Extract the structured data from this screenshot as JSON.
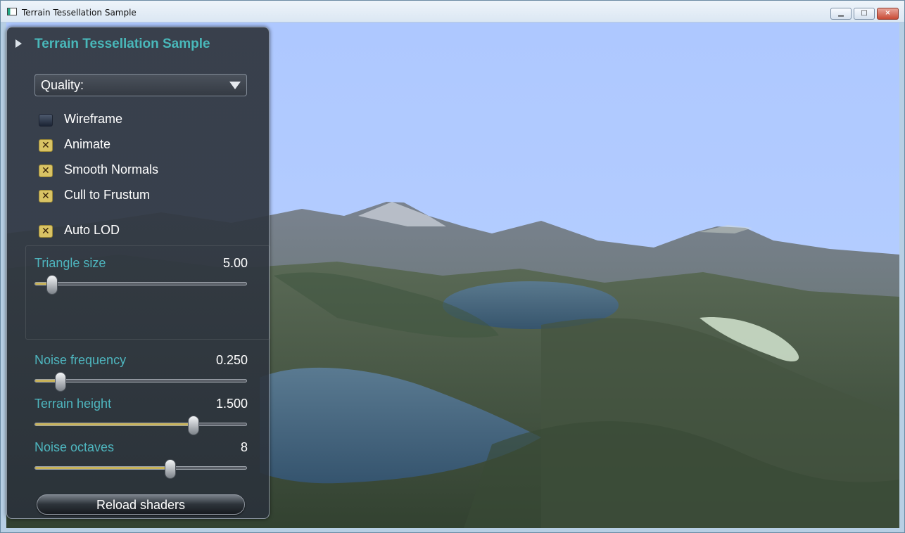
{
  "window": {
    "title": "Terrain Tessellation Sample",
    "controls": [
      "minimize",
      "maximize",
      "close"
    ]
  },
  "panel": {
    "title": "Terrain Tessellation Sample",
    "quality": {
      "label": "Quality:"
    },
    "options": [
      {
        "label": "Wireframe",
        "checked": false
      },
      {
        "label": "Animate",
        "checked": true
      },
      {
        "label": "Smooth Normals",
        "checked": true
      },
      {
        "label": "Cull to Frustum",
        "checked": true
      }
    ],
    "auto_lod": {
      "label": "Auto LOD",
      "checked": true
    },
    "sliders": {
      "triangle_size": {
        "label": "Triangle size",
        "value": "5.00",
        "level": 0.08
      },
      "noise_frequency": {
        "label": "Noise frequency",
        "value": "0.250",
        "level": 0.12
      },
      "terrain_height": {
        "label": "Terrain height",
        "value": "1.500",
        "level": 0.75
      },
      "noise_octaves": {
        "label": "Noise octaves",
        "value": "8",
        "level": 0.64
      }
    },
    "reload_button": "Reload shaders"
  },
  "colors": {
    "sky": "#b1caff",
    "panel": "#343b45",
    "label": "#49b8ba",
    "checkbox": "#d9c364",
    "water": "#3d5f7d",
    "terrain": "#4f6343"
  }
}
